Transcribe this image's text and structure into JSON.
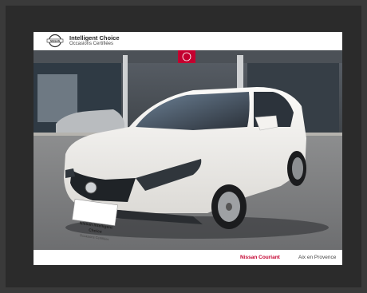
{
  "header": {
    "title": "Intelligent Choice",
    "subtitle": "Occasions Certifiées",
    "logo_text": "NISSAN"
  },
  "plate": {
    "line1": "Nissan Intelligent Choice",
    "line2": "Occasions Certifiées"
  },
  "footer": {
    "dealer": "Nissan Couriant",
    "city": "Aix en Provence"
  },
  "colors": {
    "brand_red": "#c3002f",
    "car_body": "#f2f0ec"
  }
}
